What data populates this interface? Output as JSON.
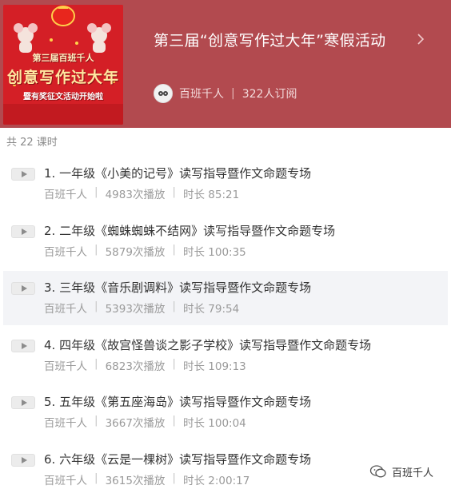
{
  "course": {
    "title": "第三届“创意写作过大年”寒假活动",
    "author": "百班千人",
    "subscribers": "322人订阅",
    "cover": {
      "line1": "第三届百班千人",
      "line2": "创意写作过大年",
      "line3": "暨有奖征文活动开始啦"
    }
  },
  "lesson_count": "共 22 课时",
  "lessons": [
    {
      "title": "1. 一年级《小美的记号》读写指导暨作文命题专场",
      "author": "百班千人",
      "plays": "4983次播放",
      "duration": "时长 85:21"
    },
    {
      "title": "2. 二年级《蜘蛛蜘蛛不结网》读写指导暨作文命题专场",
      "author": "百班千人",
      "plays": "5879次播放",
      "duration": "时长 100:35"
    },
    {
      "title": "3. 三年级《音乐剧调料》读写指导暨作文命题专场",
      "author": "百班千人",
      "plays": "5393次播放",
      "duration": "时长 79:54"
    },
    {
      "title": "4. 四年级《故宫怪兽谈之影子学校》读写指导暨作文命题专场",
      "author": "百班千人",
      "plays": "6823次播放",
      "duration": "时长 109:13"
    },
    {
      "title": "5. 五年级《第五座海岛》读写指导暨作文命题专场",
      "author": "百班千人",
      "plays": "3667次播放",
      "duration": "时长 100:04"
    },
    {
      "title": "6. 六年级《云是一棵树》读写指导暨作文命题专场",
      "author": "百班千人",
      "plays": "3615次播放",
      "duration": "时长 2:00:17"
    }
  ],
  "watermark": "百班千人",
  "colors": {
    "header": "#b24a4f",
    "active_row": "#f3f4f7"
  },
  "icons": {
    "chevron": "chevron-right-icon",
    "play": "play-icon",
    "watermark": "wechat-icon"
  }
}
